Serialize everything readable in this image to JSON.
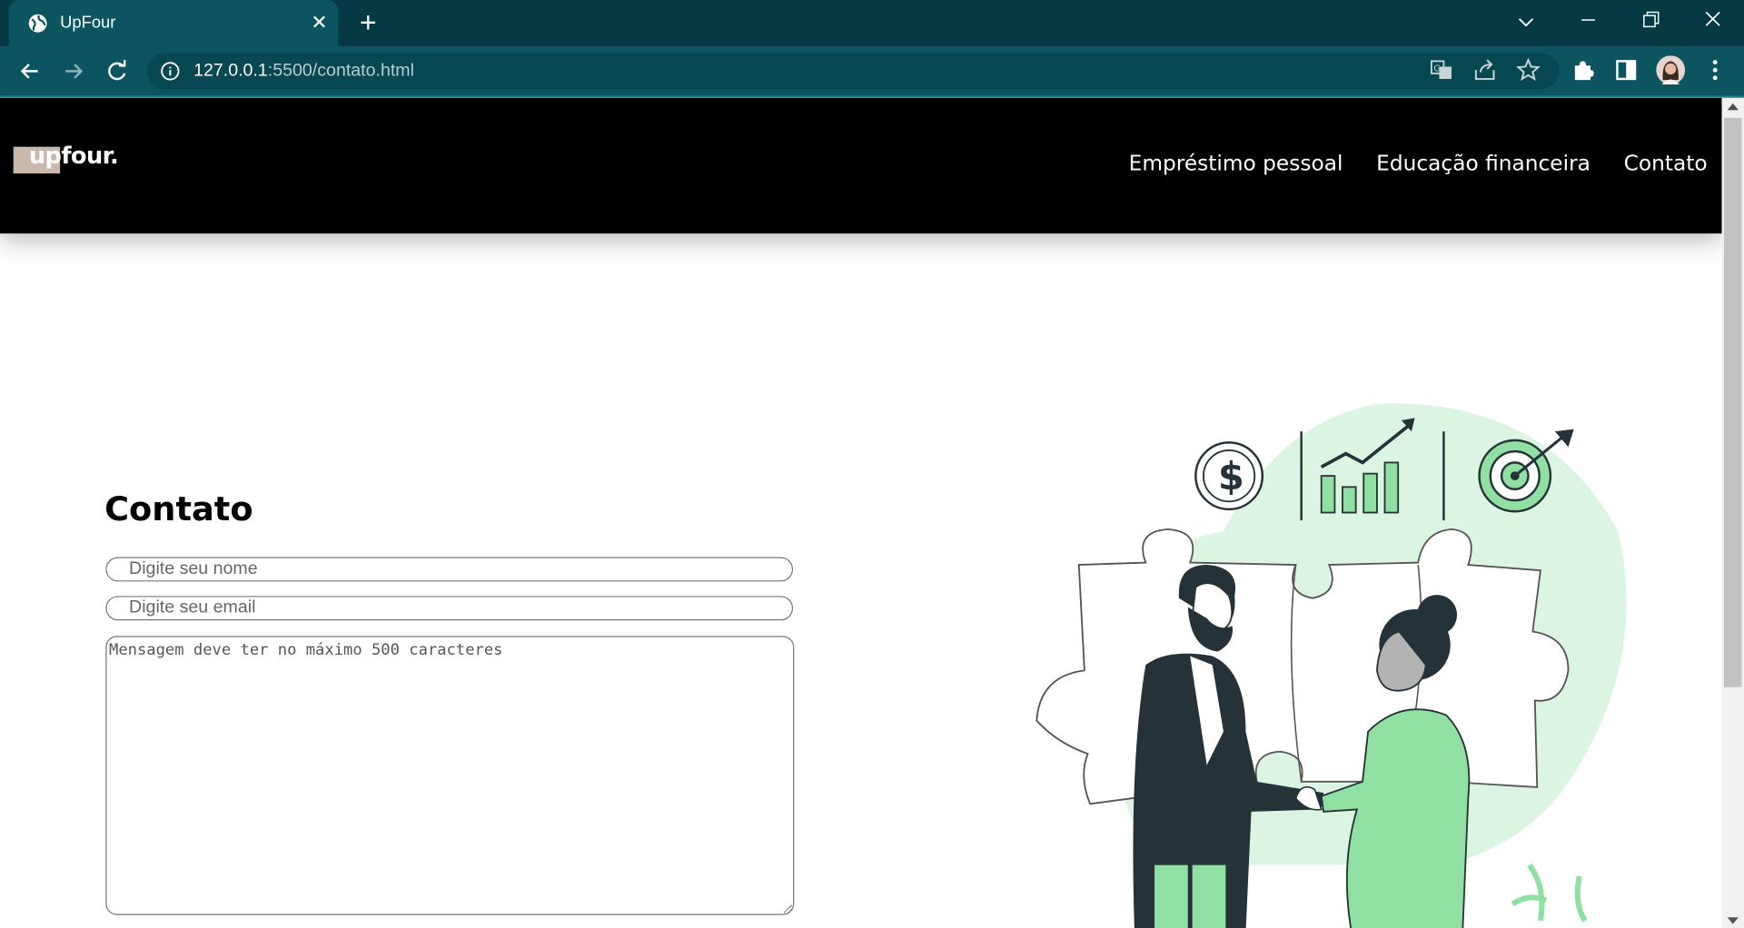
{
  "browser": {
    "tab_title": "UpFour",
    "tab_close": "✕",
    "new_tab": "+",
    "url_host": "127.0.0.1",
    "url_rest": ":5500/contato.html"
  },
  "site": {
    "logo_text": "upfour.",
    "nav": [
      "Empréstimo pessoal",
      "Educação financeira",
      "Contato"
    ]
  },
  "contact": {
    "title": "Contato",
    "name_placeholder": "Digite seu nome",
    "email_placeholder": "Digite seu email",
    "message_placeholder": "Mensagem deve ter no máximo 500 caracteres"
  },
  "colors": {
    "tab_strip": "#053a45",
    "toolbar": "#0b5460",
    "illustration_green": "#8fe0a2",
    "illustration_bg": "#dcf5e2",
    "illustration_dark": "#253238"
  },
  "icons": [
    "globe-icon",
    "close-icon",
    "plus-icon",
    "chevron-down-icon",
    "minimize-icon",
    "restore-icon",
    "window-close-icon",
    "back-icon",
    "forward-icon",
    "reload-icon",
    "info-icon",
    "translate-icon",
    "share-icon",
    "star-icon",
    "extensions-icon",
    "side-panel-icon",
    "profile-avatar",
    "menu-icon"
  ]
}
